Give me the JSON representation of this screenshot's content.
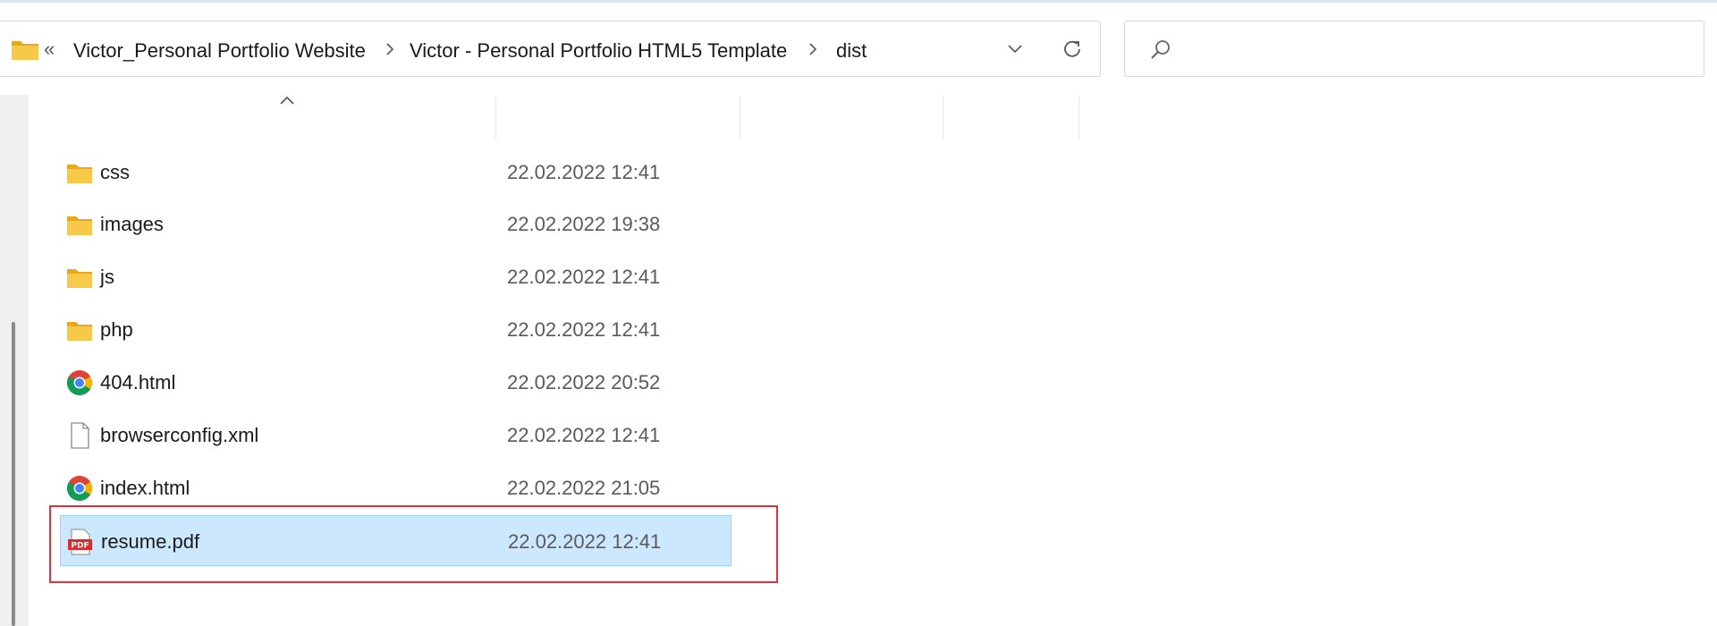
{
  "address_bar": {
    "overflow_chevrons": "«",
    "breadcrumbs": [
      "Victor_Personal Portfolio Website",
      "Victor - Personal Portfolio HTML5 Template",
      "dist"
    ]
  },
  "search": {
    "placeholder": ""
  },
  "files": [
    {
      "name": "css",
      "date": "22.02.2022 12:41",
      "type": "folder",
      "icon": "folder-icon"
    },
    {
      "name": "images",
      "date": "22.02.2022 19:38",
      "type": "folder",
      "icon": "folder-icon"
    },
    {
      "name": "js",
      "date": "22.02.2022 12:41",
      "type": "folder",
      "icon": "folder-icon"
    },
    {
      "name": "php",
      "date": "22.02.2022 12:41",
      "type": "folder",
      "icon": "folder-icon"
    },
    {
      "name": "404.html",
      "date": "22.02.2022 20:52",
      "type": "html",
      "icon": "chrome-icon"
    },
    {
      "name": "browserconfig.xml",
      "date": "22.02.2022 12:41",
      "type": "file",
      "icon": "file-icon"
    },
    {
      "name": "index.html",
      "date": "22.02.2022 21:05",
      "type": "html",
      "icon": "chrome-icon"
    },
    {
      "name": "resume.pdf",
      "date": "22.02.2022 12:41",
      "type": "pdf",
      "icon": "pdf-icon",
      "selected": true
    }
  ],
  "pdf_badge": "PDF",
  "colors": {
    "selection_bg": "#cce8ff",
    "selection_border": "#99d1ff",
    "highlight": "#e0323c",
    "folder": "#f7c948"
  }
}
